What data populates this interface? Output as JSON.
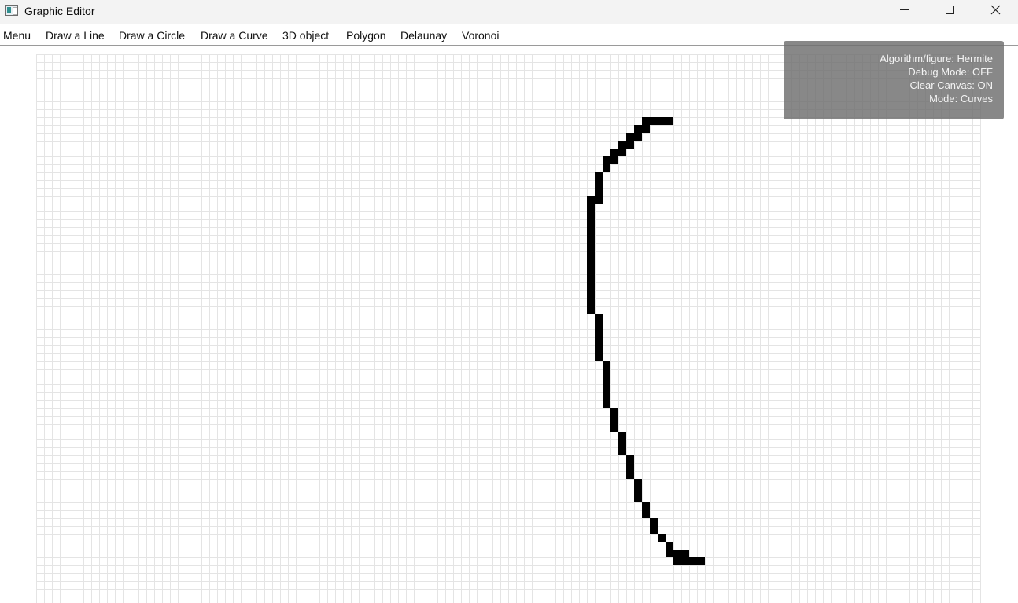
{
  "window": {
    "title": "Graphic Editor",
    "icon": "app-window-icon"
  },
  "menu": {
    "items": [
      {
        "label": "Menu"
      },
      {
        "label": "Draw a Line"
      },
      {
        "label": "Draw a Circle"
      },
      {
        "label": "Draw a Curve"
      },
      {
        "label": "3D object"
      },
      {
        "label": "Polygon"
      },
      {
        "label": "Delaunay"
      },
      {
        "label": "Voronoi"
      }
    ]
  },
  "info": {
    "algorithm": "Algorithm/figure: Hermite",
    "debug": "Debug Mode: OFF",
    "clear": "Clear Canvas: ON",
    "mode": "Mode: Curves"
  },
  "colors": {
    "pixel": "#000000",
    "grid_line": "#e4e4e4",
    "panel": "#6e6e6e"
  },
  "canvas": {
    "curve_cells": [
      [
        80,
        8
      ],
      [
        78,
        8
      ],
      [
        76,
        9
      ],
      [
        75,
        10
      ],
      [
        74,
        11
      ],
      [
        73,
        12
      ],
      [
        72,
        13
      ],
      [
        72,
        14
      ],
      [
        71,
        15
      ],
      [
        71,
        16
      ],
      [
        71,
        17
      ],
      [
        70,
        18
      ],
      [
        70,
        19
      ],
      [
        70,
        20
      ],
      [
        70,
        21
      ],
      [
        70,
        22
      ],
      [
        70,
        23
      ],
      [
        70,
        24
      ],
      [
        70,
        25
      ],
      [
        70,
        26
      ],
      [
        70,
        27
      ],
      [
        70,
        28
      ],
      [
        70,
        29
      ],
      [
        70,
        30
      ],
      [
        70,
        31
      ],
      [
        70,
        32
      ],
      [
        71,
        33
      ],
      [
        71,
        34
      ],
      [
        71,
        35
      ],
      [
        71,
        36
      ],
      [
        71,
        37
      ],
      [
        71,
        38
      ],
      [
        72,
        39
      ],
      [
        72,
        40
      ],
      [
        72,
        41
      ],
      [
        72,
        42
      ],
      [
        72,
        43
      ],
      [
        72,
        44
      ],
      [
        73,
        45
      ],
      [
        73,
        46
      ],
      [
        73,
        47
      ],
      [
        74,
        48
      ],
      [
        74,
        49
      ],
      [
        74,
        50
      ],
      [
        75,
        51
      ],
      [
        75,
        52
      ],
      [
        75,
        53
      ],
      [
        76,
        54
      ],
      [
        76,
        55
      ],
      [
        76,
        56
      ],
      [
        77,
        57
      ],
      [
        77,
        58
      ],
      [
        78,
        59
      ],
      [
        78,
        60
      ],
      [
        79,
        61
      ],
      [
        80,
        62
      ],
      [
        81,
        63
      ],
      [
        82,
        64
      ],
      [
        83,
        64
      ],
      [
        84,
        64
      ],
      [
        79,
        8
      ],
      [
        77,
        8
      ],
      [
        77,
        9
      ],
      [
        76,
        10
      ],
      [
        75,
        11
      ],
      [
        74,
        12
      ],
      [
        73,
        13
      ],
      [
        71,
        18
      ],
      [
        81,
        64
      ],
      [
        82,
        63
      ],
      [
        80,
        63
      ]
    ]
  }
}
